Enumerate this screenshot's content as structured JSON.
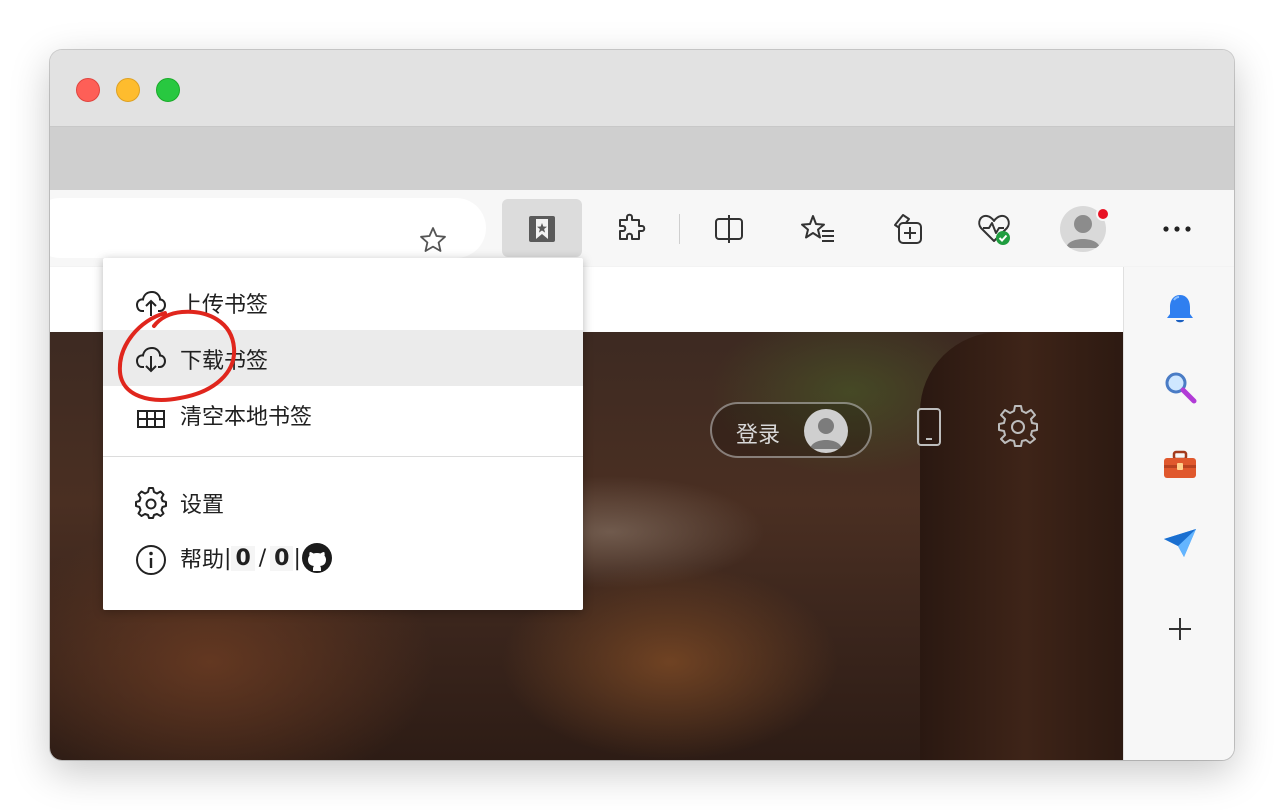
{
  "browser": {
    "address_bar": {
      "value": ""
    },
    "toolbar_icons": [
      "favorite-star-icon",
      "bookmark-sync-icon",
      "extensions-icon",
      "split-screen-icon",
      "favorites-icon",
      "collections-icon",
      "browser-essentials-icon",
      "profile-icon",
      "more-icon"
    ]
  },
  "menu": {
    "upload_label": "上传书签",
    "download_label": "下载书签",
    "clear_label": "清空本地书签",
    "settings_label": "设置",
    "help_label": "帮助",
    "help_sep1": "|",
    "help_count_a": "0",
    "help_slash": "/",
    "help_count_b": "0",
    "help_sep2": "|"
  },
  "page": {
    "login_label": "登录"
  },
  "sidebar": {
    "icons": [
      "bell-icon",
      "search-icon",
      "toolbox-icon",
      "send-icon",
      "plus-icon"
    ]
  },
  "colors": {
    "annotation_red": "#e0261d",
    "hover_bg": "#ebebeb",
    "avatar_dot": "#e81123",
    "essentials_badge": "#1f9d3f"
  }
}
